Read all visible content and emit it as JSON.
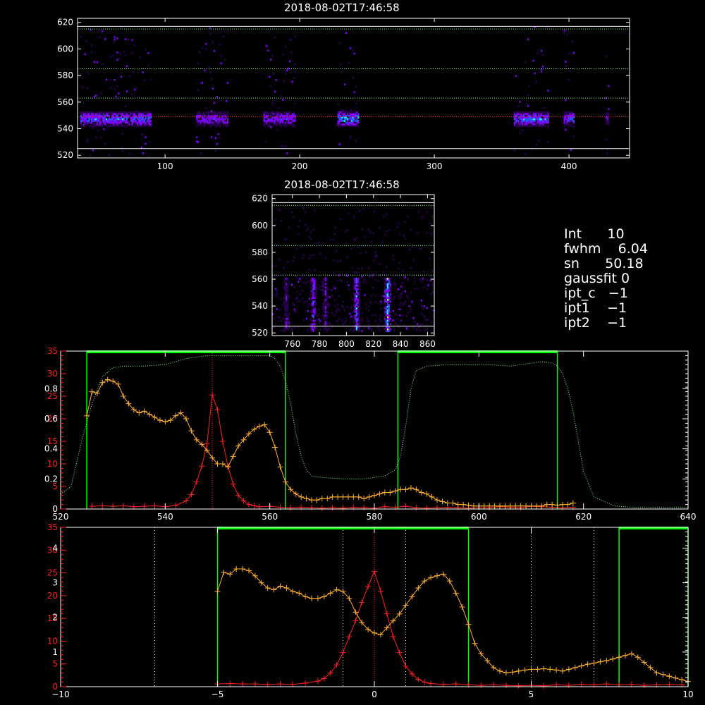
{
  "image_title": "2018-08-02T17:46:58",
  "info": {
    "lines": [
      {
        "label": "Int",
        "value": "10"
      },
      {
        "label": "fwhm",
        "value": "6.04"
      },
      {
        "label": "sn",
        "value": "50.18"
      },
      {
        "label": "gaussfit",
        "value": "0"
      },
      {
        "label": "ipt_c",
        "value": "−1"
      },
      {
        "label": "ipt1",
        "value": "−1"
      },
      {
        "label": "ipt2",
        "value": "−1"
      }
    ]
  },
  "colors": {
    "red": "#ff2020",
    "orange": "#ffb030",
    "green": "#00ff00",
    "grid_green": "#80ff80",
    "spectrum_low": "#2a0050",
    "spectrum_mid": "#8000ff",
    "spectrum_high": "#00ffff",
    "spectrum_peak": "#ffff00"
  },
  "chart_data": [
    {
      "type": "heatmap",
      "title": "2018-08-02T17:46:58",
      "xlim": [
        35,
        445
      ],
      "ylim": [
        518,
        623
      ],
      "xticks": [
        100,
        200,
        300,
        400
      ],
      "yticks": [
        520,
        540,
        560,
        580,
        600,
        620
      ],
      "hlines": [
        {
          "y": 525,
          "color": "#ffffff"
        },
        {
          "y": 617,
          "color": "#ffffff"
        },
        {
          "y": 549,
          "color": "#ff2020"
        },
        {
          "y": 563,
          "color": "#80ff80"
        },
        {
          "y": 585,
          "color": "#80ff80"
        },
        {
          "y": 615,
          "color": "#80ff80"
        }
      ],
      "bright_blocks": [
        {
          "x": [
            37,
            90
          ],
          "peak": 0.8
        },
        {
          "x": [
            123,
            147
          ],
          "peak": 0.55
        },
        {
          "x": [
            173,
            197
          ],
          "peak": 0.6
        },
        {
          "x": [
            228,
            244
          ],
          "peak": 1.0
        },
        {
          "x": [
            359,
            385
          ],
          "peak": 0.8
        },
        {
          "x": [
            396,
            404
          ],
          "peak": 0.7
        },
        {
          "x": [
            427,
            430
          ],
          "peak": 0.4
        }
      ]
    },
    {
      "type": "heatmap",
      "title": "2018-08-02T17:46:58",
      "xlim": [
        745,
        865
      ],
      "ylim": [
        518,
        623
      ],
      "xticks": [
        760,
        780,
        800,
        820,
        840,
        860
      ],
      "yticks": [
        520,
        540,
        560,
        580,
        600,
        620
      ],
      "hlines": [
        {
          "y": 525,
          "color": "#ffffff"
        },
        {
          "y": 617,
          "color": "#ffffff"
        },
        {
          "y": 563,
          "color": "#80ff80"
        },
        {
          "y": 585,
          "color": "#80ff80"
        },
        {
          "y": 615,
          "color": "#80ff80"
        }
      ],
      "streaks": [
        {
          "x": 755,
          "peak": 0.35
        },
        {
          "x": 775,
          "peak": 0.55
        },
        {
          "x": 784,
          "peak": 0.35
        },
        {
          "x": 807,
          "peak": 0.75
        },
        {
          "x": 830,
          "peak": 1.0
        }
      ]
    },
    {
      "type": "line",
      "xlim": [
        520,
        640
      ],
      "xticks": [
        520,
        540,
        560,
        580,
        600,
        620,
        640
      ],
      "left_axis_red": {
        "ylim": [
          0,
          35
        ],
        "ticks": [
          0,
          5,
          10,
          15,
          20,
          25,
          30,
          35
        ]
      },
      "left_axis_white": {
        "ylim": [
          0,
          1.05
        ],
        "ticks": [
          0.0,
          0.2,
          0.4,
          0.6,
          0.8
        ]
      },
      "green_bands": [
        [
          525,
          563
        ],
        [
          584.5,
          615
        ]
      ],
      "vline_red": 549,
      "series": [
        {
          "color": "#ff2020",
          "marker": "+",
          "x": [
            526,
            528,
            530,
            532,
            534,
            536,
            538,
            540,
            542,
            544,
            545,
            546,
            547,
            548,
            549,
            550,
            551,
            552,
            553,
            554,
            555,
            556,
            557,
            558,
            560,
            562,
            564,
            566,
            568,
            570,
            572,
            574,
            576,
            578,
            580,
            582,
            584,
            586,
            588,
            590,
            592,
            594,
            596,
            598,
            600,
            602,
            604,
            606,
            608,
            610,
            612,
            614,
            616,
            618
          ],
          "values": [
            0.6,
            0.7,
            0.6,
            0.7,
            0.5,
            0.6,
            0.7,
            0.5,
            0.8,
            1.8,
            3.2,
            6.0,
            9.5,
            14.5,
            25.3,
            22.0,
            15.0,
            9.5,
            5.5,
            3.0,
            1.8,
            1.0,
            0.7,
            0.5,
            0.6,
            0.4,
            0.3,
            0.4,
            0.3,
            0.2,
            0.3,
            0.2,
            0.4,
            0.3,
            0.2,
            0.5,
            0.4,
            0.6,
            0.3,
            0.2,
            0.3,
            0.4,
            0.3,
            0.2,
            0.3,
            0.3,
            0.5,
            0.4,
            0.3,
            0.6,
            0.5,
            0.4,
            0.3,
            0.4
          ]
        },
        {
          "color": "#ffb030",
          "marker": "+",
          "x": [
            525,
            526,
            527,
            528,
            529,
            530,
            531,
            532,
            533,
            534,
            535,
            536,
            537,
            538,
            539,
            540,
            541,
            542,
            543,
            544,
            545,
            546,
            547,
            548,
            549,
            550,
            551,
            552,
            553,
            554,
            555,
            556,
            557,
            558,
            559,
            560,
            561,
            562,
            563,
            564,
            565,
            566,
            567,
            568,
            569,
            570,
            571,
            572,
            573,
            574,
            575,
            576,
            577,
            578,
            579,
            580,
            581,
            582,
            583,
            584,
            585,
            586,
            587,
            588,
            589,
            590,
            591,
            592,
            593,
            594,
            595,
            596,
            597,
            598,
            599,
            600,
            601,
            602,
            603,
            604,
            605,
            606,
            607,
            608,
            609,
            610,
            611,
            612,
            613,
            614,
            615,
            616,
            617,
            618
          ],
          "values": [
            0.62,
            0.78,
            0.77,
            0.84,
            0.86,
            0.85,
            0.83,
            0.75,
            0.7,
            0.66,
            0.64,
            0.65,
            0.63,
            0.61,
            0.59,
            0.58,
            0.59,
            0.62,
            0.64,
            0.6,
            0.52,
            0.46,
            0.43,
            0.39,
            0.34,
            0.3,
            0.3,
            0.28,
            0.35,
            0.42,
            0.46,
            0.5,
            0.53,
            0.55,
            0.56,
            0.51,
            0.41,
            0.28,
            0.18,
            0.13,
            0.1,
            0.08,
            0.07,
            0.06,
            0.06,
            0.07,
            0.07,
            0.08,
            0.08,
            0.08,
            0.08,
            0.08,
            0.08,
            0.07,
            0.08,
            0.09,
            0.1,
            0.11,
            0.11,
            0.12,
            0.13,
            0.13,
            0.14,
            0.13,
            0.11,
            0.1,
            0.08,
            0.06,
            0.05,
            0.04,
            0.04,
            0.03,
            0.03,
            0.025,
            0.02,
            0.02,
            0.02,
            0.02,
            0.02,
            0.02,
            0.02,
            0.02,
            0.02,
            0.02,
            0.02,
            0.02,
            0.02,
            0.02,
            0.03,
            0.03,
            0.025,
            0.03,
            0.03,
            0.04
          ]
        },
        {
          "color": "#80ff80",
          "style": "dotted",
          "x": [
            520,
            522,
            524,
            526,
            528,
            530,
            532,
            534,
            536,
            540,
            544,
            548,
            552,
            556,
            558,
            560,
            561,
            562,
            563,
            564,
            565,
            566,
            567,
            568,
            570,
            574,
            578,
            580,
            582,
            584,
            585,
            586,
            587,
            588,
            590,
            594,
            598,
            602,
            606,
            610,
            612,
            614,
            615,
            616,
            617,
            618,
            619,
            620,
            622,
            626,
            630,
            640
          ],
          "values": [
            0.1,
            0.15,
            0.45,
            0.7,
            0.88,
            0.94,
            0.95,
            0.95,
            0.95,
            0.96,
            1.0,
            1.02,
            1.02,
            1.02,
            1.02,
            1.02,
            1.0,
            0.95,
            0.85,
            0.7,
            0.5,
            0.35,
            0.26,
            0.22,
            0.21,
            0.2,
            0.2,
            0.21,
            0.22,
            0.26,
            0.35,
            0.55,
            0.8,
            0.92,
            0.95,
            0.96,
            0.96,
            0.96,
            0.95,
            0.97,
            0.98,
            0.97,
            0.95,
            0.9,
            0.8,
            0.65,
            0.45,
            0.25,
            0.08,
            0.02,
            0.01,
            0.01
          ]
        }
      ]
    },
    {
      "type": "line",
      "xlim": [
        -10,
        10
      ],
      "xticks": [
        -10,
        -5,
        0,
        5,
        10
      ],
      "left_axis_red": {
        "ylim": [
          0,
          35
        ],
        "ticks": [
          0,
          5,
          10,
          15,
          20,
          25,
          30,
          35
        ]
      },
      "left_axis_white": {
        "ylim": [
          0,
          4.6
        ],
        "ticks": [
          1,
          2,
          3,
          4
        ]
      },
      "vlines_white": [
        -7,
        -1,
        1,
        5,
        7
      ],
      "vline_red": 0,
      "green_bands": [
        [
          -5,
          3
        ],
        [
          7.8,
          10
        ]
      ],
      "series": [
        {
          "color": "#ff2020",
          "marker": "+",
          "x": [
            -5,
            -4.6,
            -4.2,
            -3.8,
            -3.4,
            -3.0,
            -2.6,
            -2.2,
            -1.8,
            -1.6,
            -1.4,
            -1.2,
            -1.0,
            -0.8,
            -0.6,
            -0.4,
            -0.2,
            0,
            0.2,
            0.4,
            0.6,
            0.8,
            1.0,
            1.2,
            1.4,
            1.6,
            1.8,
            2.2,
            2.6,
            3.0,
            3.4,
            3.8,
            4.2,
            4.6,
            5.0,
            5.4,
            5.8,
            6.2,
            6.6,
            7.0,
            7.4,
            7.8,
            8.2,
            8.6,
            9.0,
            9.4,
            9.8
          ],
          "values": [
            0.6,
            0.7,
            0.6,
            0.6,
            0.5,
            0.6,
            0.5,
            0.8,
            1.2,
            1.8,
            3.0,
            4.8,
            7.5,
            11.0,
            14.5,
            18.5,
            22.0,
            25.3,
            21.0,
            16.0,
            11.0,
            7.5,
            4.5,
            2.8,
            1.6,
            1.0,
            0.7,
            0.5,
            0.6,
            0.4,
            0.3,
            0.4,
            0.3,
            0.2,
            0.3,
            0.2,
            0.4,
            0.3,
            0.5,
            0.4,
            0.6,
            0.4,
            0.5,
            0.3,
            0.4,
            0.5,
            0.4
          ]
        },
        {
          "color": "#ffb030",
          "marker": "+",
          "x": [
            -5,
            -4.8,
            -4.6,
            -4.4,
            -4.2,
            -4.0,
            -3.8,
            -3.6,
            -3.4,
            -3.2,
            -3.0,
            -2.8,
            -2.6,
            -2.4,
            -2.2,
            -2.0,
            -1.8,
            -1.6,
            -1.4,
            -1.2,
            -1.0,
            -0.8,
            -0.6,
            -0.4,
            -0.2,
            0,
            0.2,
            0.4,
            0.6,
            0.8,
            1.0,
            1.2,
            1.4,
            1.6,
            1.8,
            2.0,
            2.2,
            2.4,
            2.6,
            2.8,
            3.0,
            3.2,
            3.4,
            3.6,
            3.8,
            4.0,
            4.2,
            4.4,
            4.6,
            4.8,
            5.0,
            5.2,
            5.4,
            5.6,
            5.8,
            6.0,
            6.2,
            6.4,
            6.6,
            6.8,
            7.0,
            7.2,
            7.4,
            7.6,
            7.8,
            8.0,
            8.2,
            8.4,
            8.6,
            8.8,
            9.0,
            9.2,
            9.4,
            9.6,
            9.8,
            10.0
          ],
          "values": [
            2.75,
            3.3,
            3.25,
            3.4,
            3.4,
            3.35,
            3.2,
            3.0,
            2.85,
            2.8,
            2.9,
            2.85,
            2.75,
            2.7,
            2.6,
            2.55,
            2.55,
            2.6,
            2.7,
            2.8,
            2.75,
            2.55,
            2.15,
            1.85,
            1.65,
            1.55,
            1.5,
            1.7,
            1.9,
            2.1,
            2.35,
            2.6,
            2.85,
            3.05,
            3.15,
            3.2,
            3.25,
            3.05,
            2.7,
            2.3,
            1.8,
            1.25,
            0.95,
            0.75,
            0.55,
            0.45,
            0.4,
            0.42,
            0.45,
            0.48,
            0.5,
            0.5,
            0.52,
            0.5,
            0.48,
            0.45,
            0.5,
            0.55,
            0.6,
            0.65,
            0.68,
            0.72,
            0.75,
            0.8,
            0.85,
            0.9,
            0.95,
            0.85,
            0.7,
            0.55,
            0.4,
            0.35,
            0.3,
            0.25,
            0.2,
            0.15
          ]
        }
      ]
    }
  ]
}
